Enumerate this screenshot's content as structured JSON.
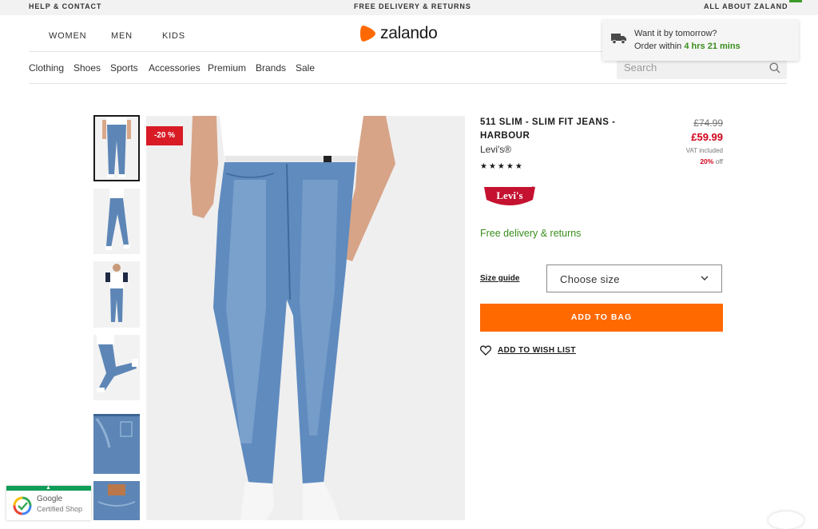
{
  "topbar": {
    "help": "HELP & CONTACT",
    "delivery": "FREE DELIVERY & RETURNS",
    "about": "ALL ABOUT ZALAND"
  },
  "header": {
    "nav": [
      "WOMEN",
      "MEN",
      "KIDS"
    ],
    "logo_text": "zalando",
    "categories": [
      "Clothing",
      "Shoes",
      "Sports",
      "Accessories",
      "Premium",
      "Brands",
      "Sale"
    ],
    "search_placeholder": "Search"
  },
  "delivery_popup": {
    "title": "Want it by tomorrow?",
    "order_prefix": "Order within",
    "countdown": "4 hrs 21 mins"
  },
  "gallery": {
    "thumbnail_count": 6,
    "selected_index": 0,
    "discount_badge": "-20 %"
  },
  "product": {
    "name_line1": "511 SLIM - SLIM FIT JEANS -",
    "name_line2": "HARBOUR",
    "brand": "Levi's®",
    "rating_stars": "★★★★★",
    "rating": 5,
    "old_price": "£74.99",
    "new_price": "£59.99",
    "vat": "VAT included",
    "discount_pct": "20%",
    "discount_suffix": "off",
    "brand_logo_text": "Levi's",
    "free_delivery": "Free delivery & returns",
    "size_guide": "Size guide",
    "size_select": "Choose size",
    "add_to_bag": "ADD TO BAG",
    "wishlist": "ADD TO WISH LIST"
  },
  "google_badge": {
    "line1": "Google",
    "line2": "Certified Shop"
  },
  "colors": {
    "accent_orange": "#ff6900",
    "sale_red": "#d0011b",
    "success_green": "#3a8e1e",
    "badge_red": "#d91b26",
    "levis_red": "#c41230"
  }
}
